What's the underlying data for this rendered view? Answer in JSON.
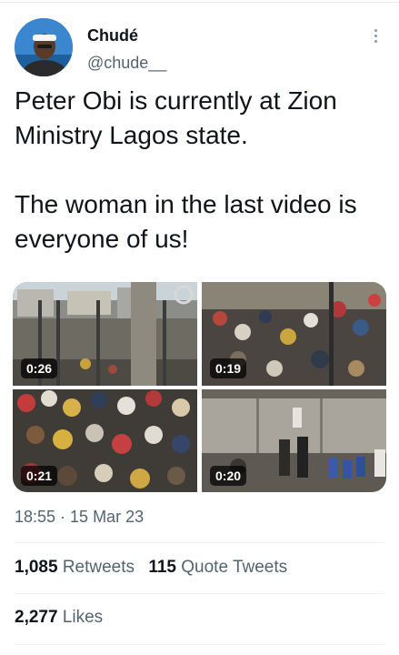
{
  "author": {
    "name": "Chudé",
    "handle": "@chude__",
    "avatar_icon": "profile-photo"
  },
  "tweet": {
    "paragraphs": [
      "Peter Obi is currently at Zion Ministry Lagos state.",
      "The woman in the last video is everyone of us!"
    ]
  },
  "media": [
    {
      "duration": "0:26"
    },
    {
      "duration": "0:19"
    },
    {
      "duration": "0:21"
    },
    {
      "duration": "0:20"
    }
  ],
  "timestamp": "18:55 · 15 Mar 23",
  "stats": {
    "retweets_count": "1,085",
    "retweets_label": "Retweets",
    "quotes_count": "115",
    "quotes_label": "Quote Tweets",
    "likes_count": "2,277",
    "likes_label": "Likes"
  },
  "colors": {
    "text": "#0f1419",
    "secondary": "#536471",
    "divider": "#eff3f4"
  }
}
